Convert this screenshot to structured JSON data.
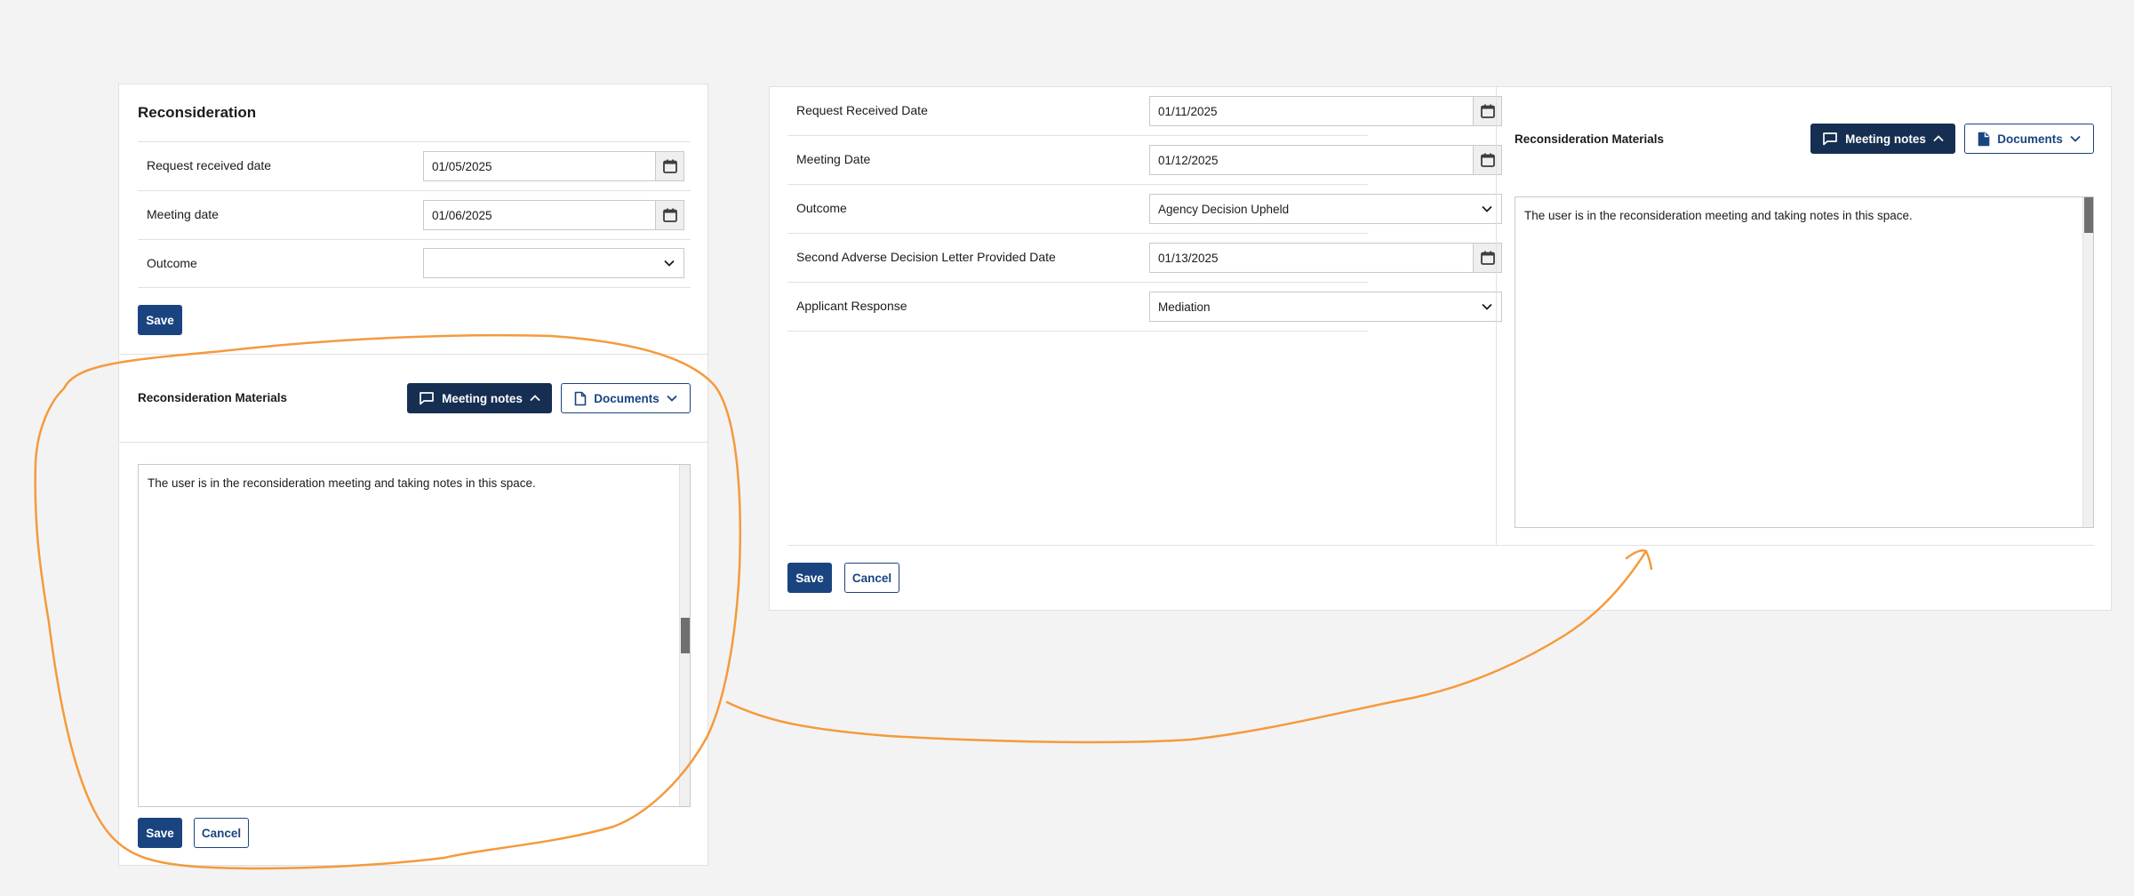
{
  "left_panel": {
    "title": "Reconsideration",
    "fields": [
      {
        "label": "Request received date",
        "value": "01/05/2025",
        "type": "date"
      },
      {
        "label": "Meeting date",
        "value": "01/06/2025",
        "type": "date"
      },
      {
        "label": "Outcome",
        "value": "",
        "type": "select"
      }
    ],
    "save_label": "Save",
    "materials": {
      "title": "Reconsideration Materials",
      "meeting_notes_label": "Meeting notes",
      "documents_label": "Documents",
      "notes_text": "The user is in the reconsideration meeting and taking notes in this space.",
      "notes_scroll_fraction": 0.5
    },
    "bottom_save_label": "Save",
    "cancel_label": "Cancel"
  },
  "right_panel": {
    "fields": [
      {
        "label": "Request Received Date",
        "value": "01/11/2025",
        "type": "date"
      },
      {
        "label": "Meeting Date",
        "value": "01/12/2025",
        "type": "date"
      },
      {
        "label": "Outcome",
        "value": "Agency Decision Upheld",
        "type": "select"
      },
      {
        "label": "Second Adverse Decision Letter Provided Date",
        "value": "01/13/2025",
        "type": "date"
      },
      {
        "label": "Applicant Response",
        "value": "Mediation",
        "type": "select"
      }
    ],
    "materials": {
      "title": "Reconsideration Materials",
      "meeting_notes_label": "Meeting notes",
      "documents_label": "Documents",
      "notes_text": "The user is in the reconsideration meeting and taking notes in this space.",
      "notes_scroll_fraction": 0
    },
    "save_label": "Save",
    "cancel_label": "Cancel"
  },
  "icons": {
    "calendar": "calendar-icon",
    "chevron_down": "chevron-down-icon",
    "chevron_up": "chevron-up-icon",
    "comment": "comment-icon",
    "document": "document-icon"
  },
  "colors": {
    "primary": "#1a4480",
    "dark_button": "#162e51",
    "annotation": "#f59a3c",
    "background": "#f3f3f3"
  }
}
